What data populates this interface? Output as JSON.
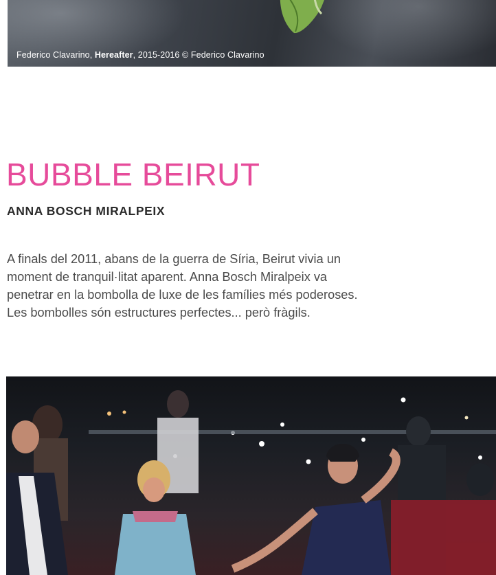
{
  "top_image": {
    "caption": {
      "author": "Federico Clavarino,",
      "work": "Hereafter",
      "rest": ", 2015-2016 © Federico Clavarino"
    }
  },
  "section": {
    "title": "BUBBLE BEIRUT",
    "author": "ANNA BOSCH MIRALPEIX",
    "body_lines": [
      "A finals del 2011, abans de la guerra de Síria, Beirut vivia un",
      "moment de tranquil·litat aparent. Anna Bosch Miralpeix va",
      "penetrar en la bombolla de luxe de les famílies més poderoses.",
      "Les bombolles són estructures perfectes... però fràgils."
    ]
  },
  "colors": {
    "accent_pink": "#e64b9a",
    "text_dark": "#2b2b2b",
    "text_body": "#4a4a4a"
  }
}
